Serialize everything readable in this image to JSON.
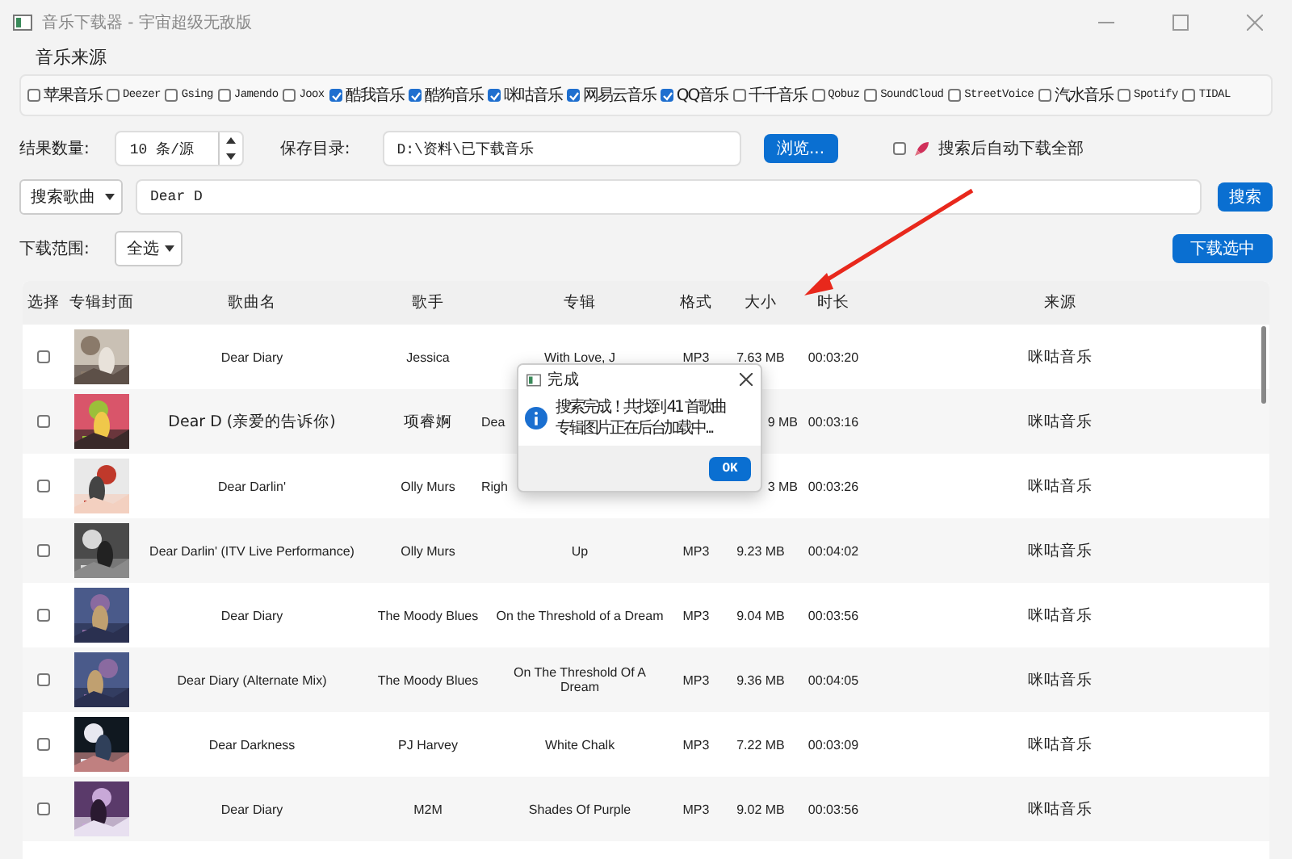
{
  "window": {
    "title": "音乐下载器 - 宇宙超级无敌版"
  },
  "sources": {
    "title": "音乐来源",
    "items": [
      {
        "label": "苹果音乐",
        "checked": false
      },
      {
        "label": "Deezer",
        "checked": false
      },
      {
        "label": "Gsing",
        "checked": false
      },
      {
        "label": "Jamendo",
        "checked": false
      },
      {
        "label": "Joox",
        "checked": false
      },
      {
        "label": "酷我音乐",
        "checked": true
      },
      {
        "label": "酷狗音乐",
        "checked": true
      },
      {
        "label": "咪咕音乐",
        "checked": true
      },
      {
        "label": "网易云音乐",
        "checked": true
      },
      {
        "label": "QQ音乐",
        "checked": true
      },
      {
        "label": "千千音乐",
        "checked": false
      },
      {
        "label": "Qobuz",
        "checked": false
      },
      {
        "label": "SoundCloud",
        "checked": false
      },
      {
        "label": "StreetVoice",
        "checked": false
      },
      {
        "label": "汽水音乐",
        "checked": false
      },
      {
        "label": "Spotify",
        "checked": false
      },
      {
        "label": "TIDAL",
        "checked": false
      }
    ]
  },
  "options": {
    "count_label": "结果数量:",
    "count_value": "10 条/源",
    "dir_label": "保存目录:",
    "dir_value": "D:\\资料\\已下载音乐",
    "browse": "浏览...",
    "auto_download": {
      "label": "搜索后自动下载全部",
      "checked": false
    }
  },
  "search": {
    "mode": "搜索歌曲",
    "query": "Dear D",
    "button": "搜索"
  },
  "range": {
    "label": "下载范围:",
    "value": "全选",
    "button": "下载选中"
  },
  "table": {
    "columns": [
      "选择",
      "专辑封面",
      "歌曲名",
      "歌手",
      "专辑",
      "格式",
      "大小",
      "时长",
      "来源"
    ],
    "rows": [
      {
        "checked": false,
        "song": "Dear Diary",
        "singer": "Jessica",
        "album": "With Love, J",
        "format": "MP3",
        "size": "7.63 MB",
        "duration": "00:03:20",
        "source": "咪咕音乐"
      },
      {
        "checked": false,
        "song": "Dear D (亲爱的告诉你)",
        "singer": "项睿婀",
        "album": "Dea",
        "size": "9 MB",
        "covered": true,
        "duration": "00:03:16",
        "source": "咪咕音乐"
      },
      {
        "checked": false,
        "song": "Dear Darlin'",
        "singer": "Olly Murs",
        "album": "Righ",
        "size": "3 MB",
        "covered": true,
        "duration": "00:03:26",
        "source": "咪咕音乐"
      },
      {
        "checked": false,
        "song": "Dear Darlin' (ITV Live Performance)",
        "singer": "Olly Murs",
        "album": "Up",
        "format": "MP3",
        "size": "9.23 MB",
        "duration": "00:04:02",
        "source": "咪咕音乐"
      },
      {
        "checked": false,
        "song": "Dear Diary",
        "singer": "The Moody Blues",
        "album": "On the Threshold of a Dream",
        "format": "MP3",
        "size": "9.04 MB",
        "duration": "00:03:56",
        "source": "咪咕音乐"
      },
      {
        "checked": false,
        "song": "Dear Diary (Alternate Mix)",
        "singer": "The Moody Blues",
        "album": "On The Threshold Of A Dream",
        "format": "MP3",
        "size": "9.36 MB",
        "duration": "00:04:05",
        "source": "咪咕音乐"
      },
      {
        "checked": false,
        "song": "Dear Darkness",
        "singer": "PJ Harvey",
        "album": "White Chalk",
        "format": "MP3",
        "size": "7.22 MB",
        "duration": "00:03:09",
        "source": "咪咕音乐"
      },
      {
        "checked": false,
        "song": "Dear Diary",
        "singer": "M2M",
        "album": "Shades Of Purple",
        "format": "MP3",
        "size": "9.02 MB",
        "duration": "00:03:56",
        "source": "咪咕音乐"
      }
    ]
  },
  "dialog": {
    "title": "完成",
    "lines": [
      "搜索完成！共找到 41 首歌曲",
      "专辑图片正在后台加载中..."
    ],
    "button": "OK"
  }
}
